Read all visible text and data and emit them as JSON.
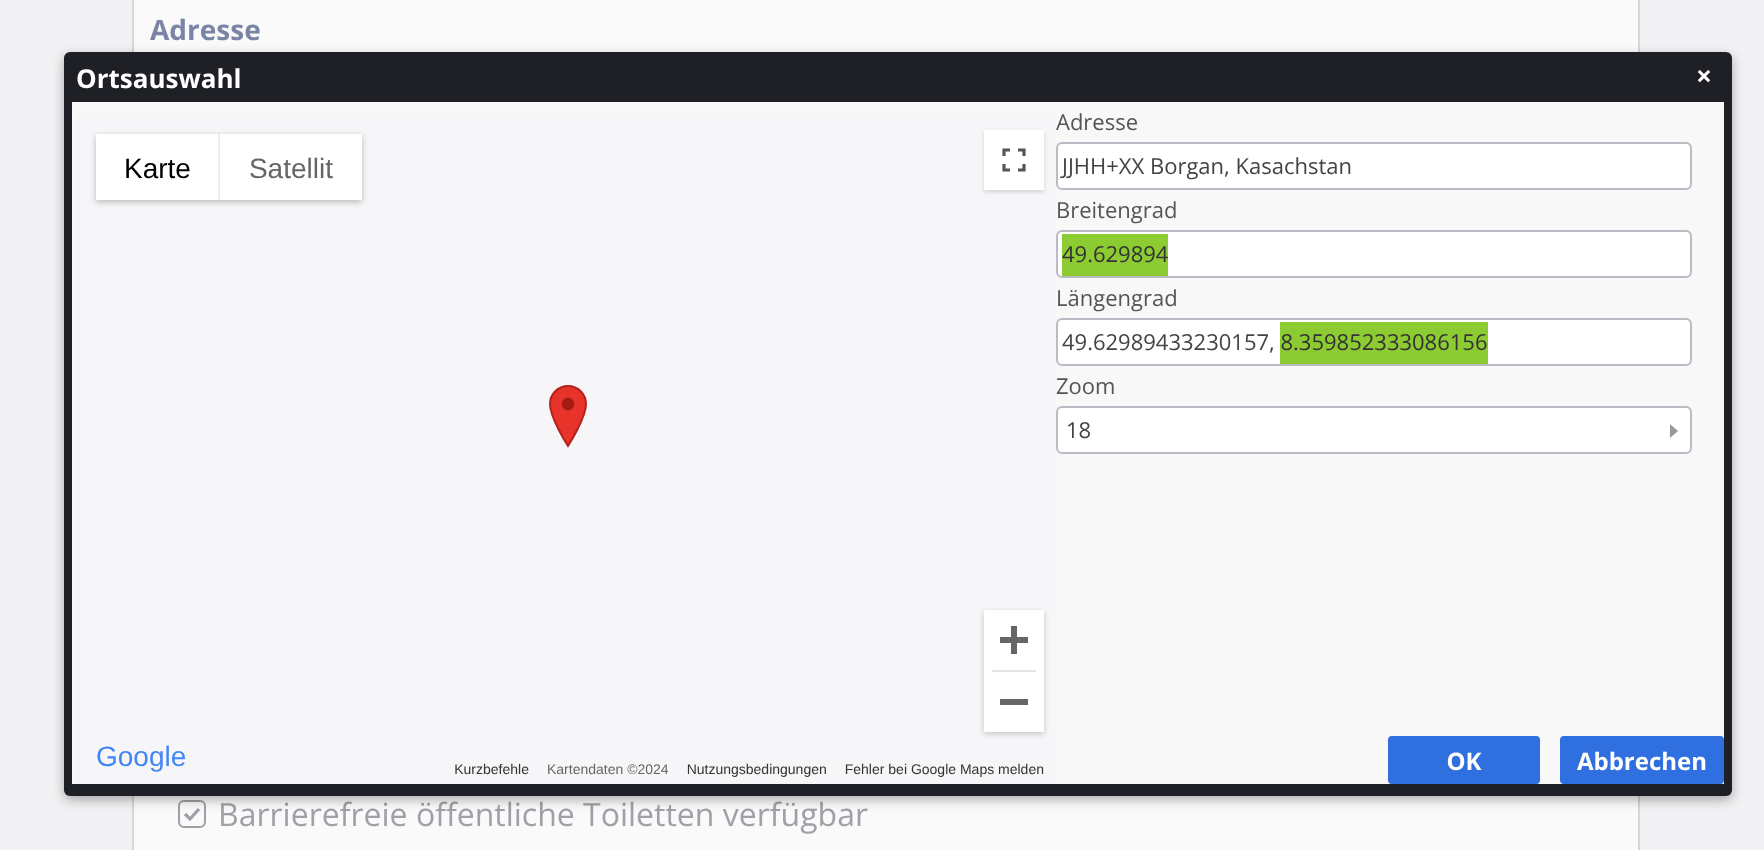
{
  "page": {
    "section_heading": "Adresse",
    "checkbox_label": "Barrierefreie öffentliche Toiletten verfügbar",
    "checked": true
  },
  "dialog": {
    "title": "Ortsauswahl",
    "close": "×"
  },
  "map": {
    "tabs": [
      {
        "label": "Karte",
        "selected": true
      },
      {
        "label": "Satellit",
        "selected": false
      }
    ],
    "logo": "Google",
    "footer_links": [
      "Kurzbefehle",
      "Kartendaten ©2024",
      "Nutzungsbedingungen",
      "Fehler bei Google Maps melden"
    ]
  },
  "fields": [
    {
      "label": "Adresse",
      "kind": "text",
      "segments": [
        {
          "text": "JJHH+XX Borgan, Kasachstan",
          "highlighted": false
        }
      ]
    },
    {
      "label": "Breitengrad",
      "kind": "text",
      "segments": [
        {
          "text": "49.629894",
          "highlighted": true
        }
      ]
    },
    {
      "label": "Längengrad",
      "kind": "text",
      "segments": [
        {
          "text": "49.62989433230157, ",
          "highlighted": false
        },
        {
          "text": "8.359852333086156",
          "highlighted": true
        }
      ]
    },
    {
      "label": "Zoom",
      "kind": "select",
      "segments": [
        {
          "text": "18",
          "highlighted": false
        }
      ]
    }
  ],
  "buttons": [
    "OK",
    "Abbrechen"
  ]
}
